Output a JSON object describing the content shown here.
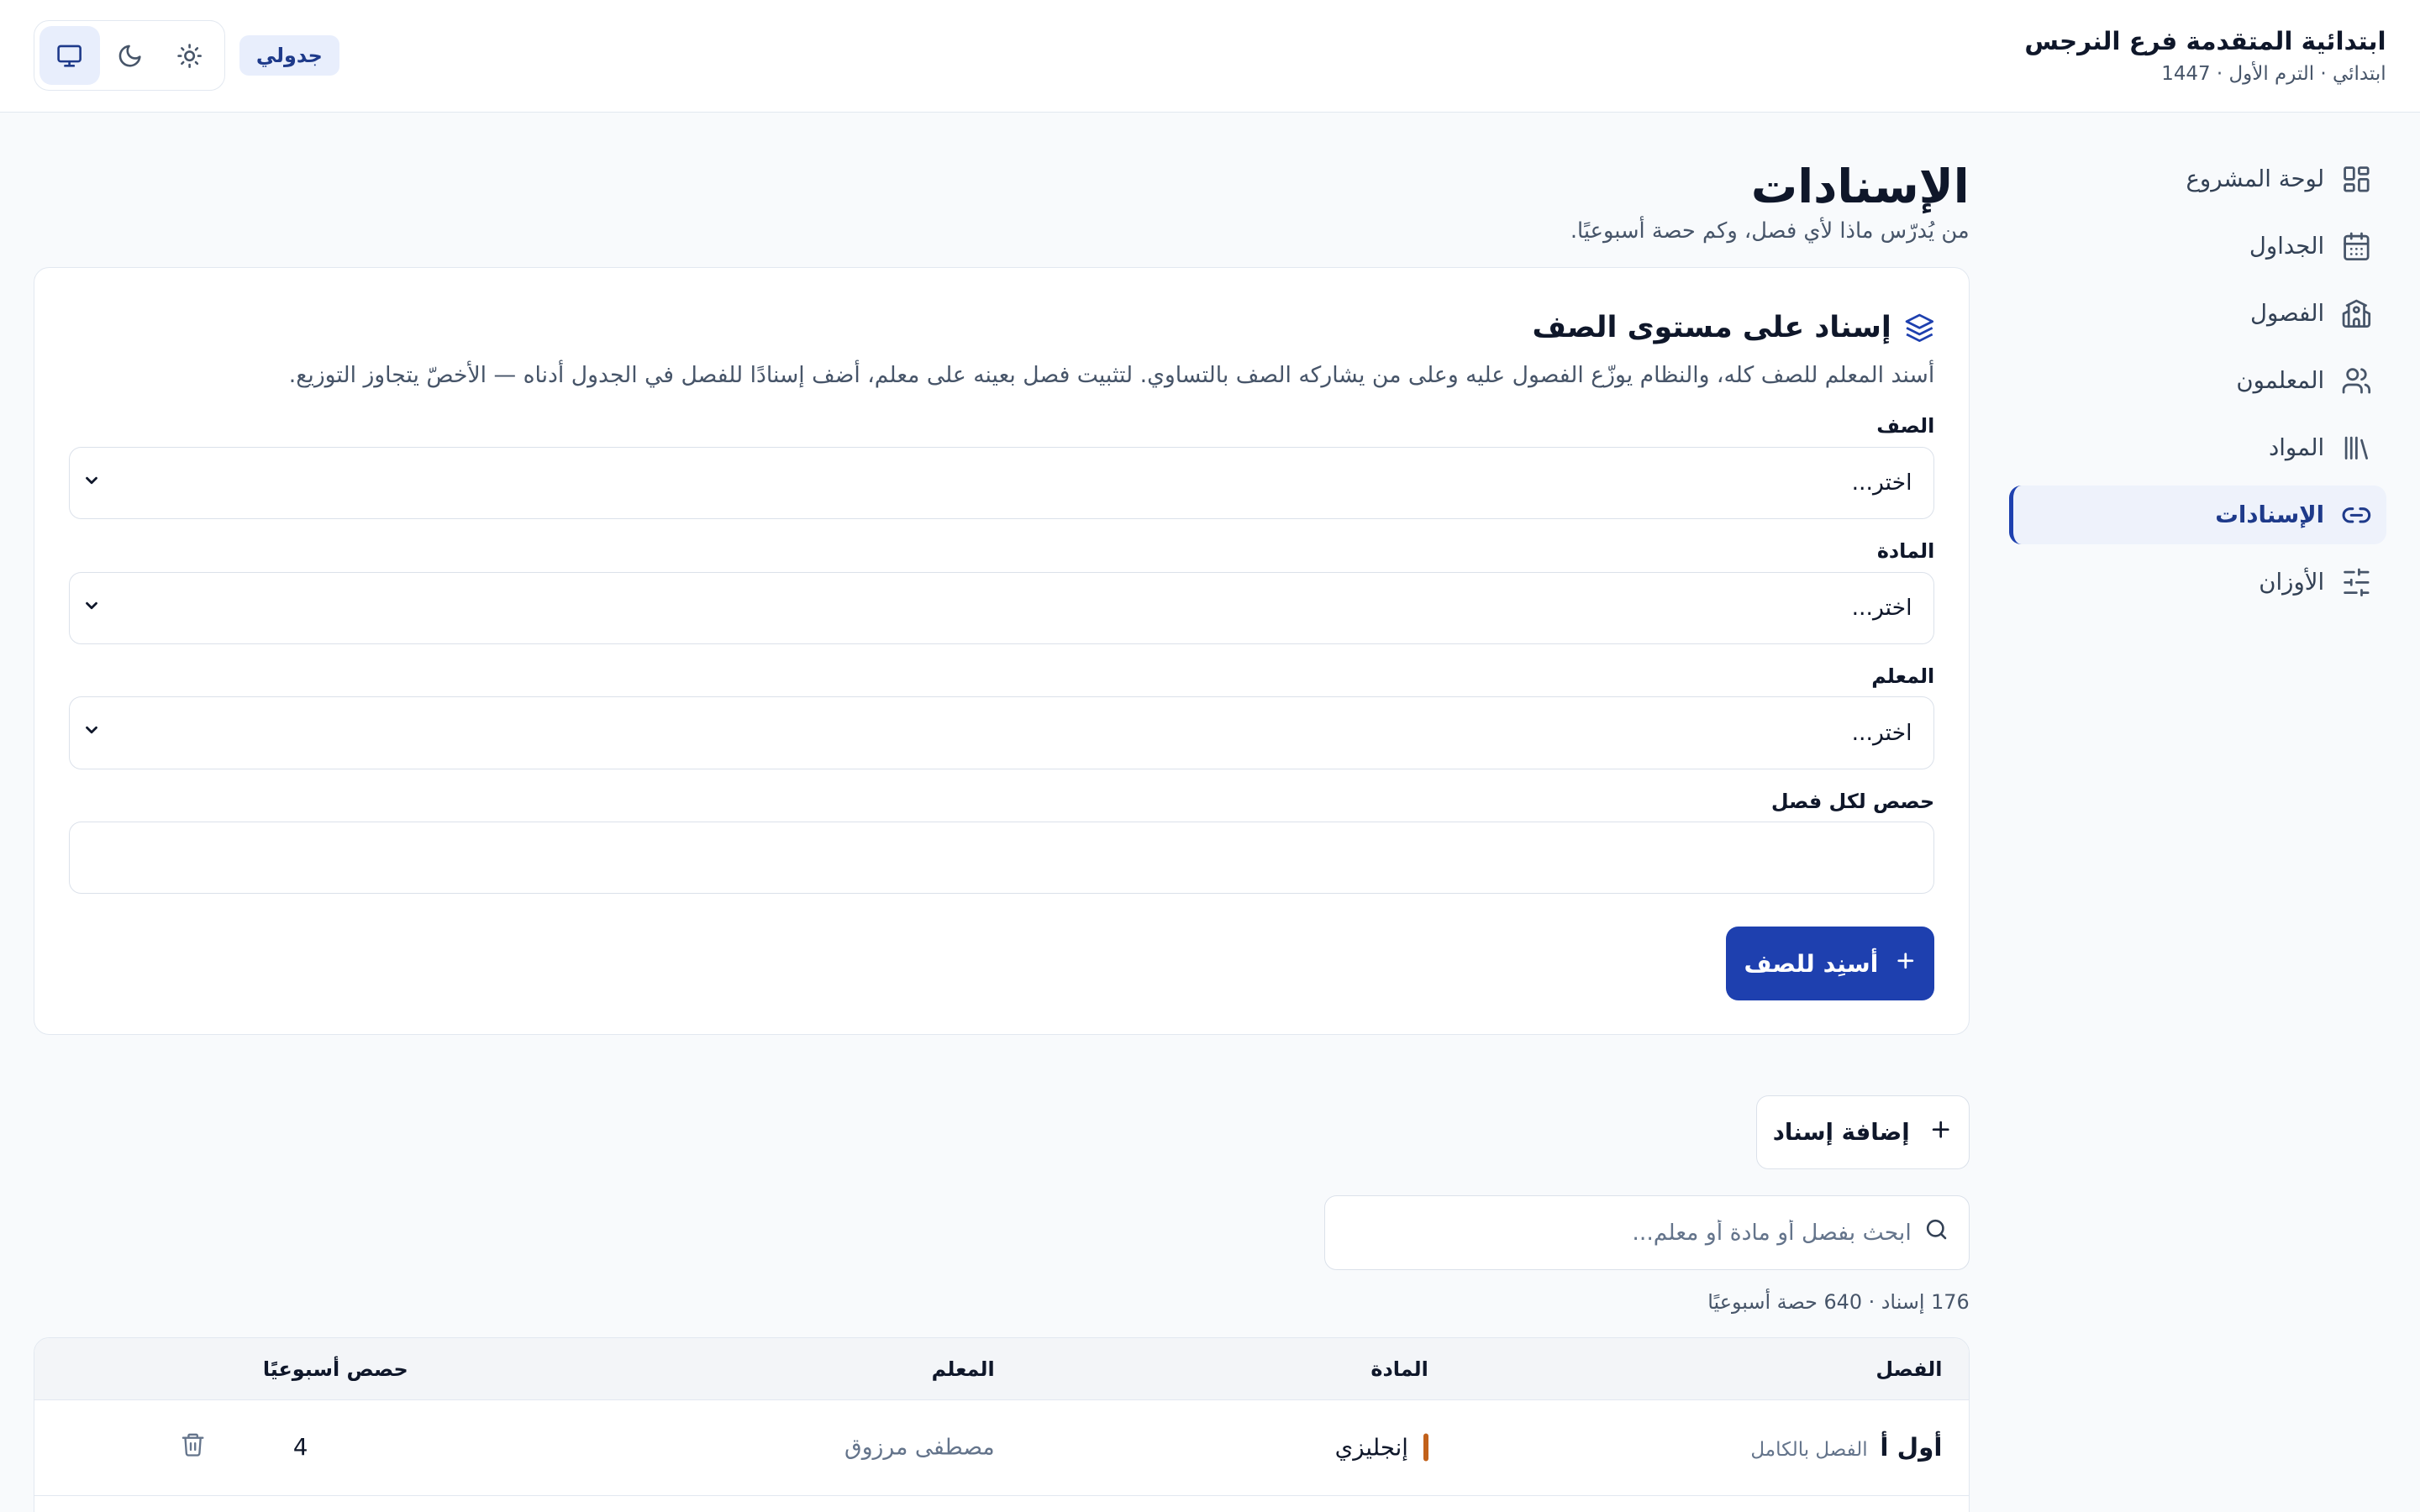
{
  "header": {
    "school_name": "ابتدائية المتقدمة فرع النرجس",
    "school_meta": "ابتدائي · الترم الأول · 1447",
    "app_badge": "جدولي"
  },
  "sidebar": {
    "items": [
      {
        "label": "لوحة المشروع",
        "icon": "grid-icon"
      },
      {
        "label": "الجداول",
        "icon": "calendar-icon"
      },
      {
        "label": "الفصول",
        "icon": "school-icon"
      },
      {
        "label": "المعلمون",
        "icon": "users-icon"
      },
      {
        "label": "المواد",
        "icon": "library-icon"
      },
      {
        "label": "الإسنادات",
        "icon": "link-icon",
        "active": true
      },
      {
        "label": "الأوزان",
        "icon": "sliders-icon"
      }
    ]
  },
  "page": {
    "title": "الإسنادات",
    "subtitle": "من يُدرّس ماذا لأي فصل، وكم حصة أسبوعيًا."
  },
  "grade_card": {
    "title": "إسناد على مستوى الصف",
    "description": "أسند المعلم للصف كله، والنظام يوزّع الفصول عليه وعلى من يشاركه الصف بالتساوي. لتثبيت فصل بعينه على معلم، أضف إسنادًا للفصل في الجدول أدناه — الأخصّ يتجاوز التوزيع.",
    "grade_label": "الصف",
    "grade_value": "اختر...",
    "subject_label": "المادة",
    "subject_value": "اختر...",
    "teacher_label": "المعلم",
    "teacher_value": "اختر...",
    "periods_label": "حصص لكل فصل",
    "periods_value": "",
    "submit_label": "أسنِد للصف"
  },
  "actions": {
    "add_label": "إضافة إسناد",
    "search_placeholder": "ابحث بفصل أو مادة أو معلم...",
    "summary": "176 إسناد · 640 حصة أسبوعيًا"
  },
  "table": {
    "columns": {
      "class": "الفصل",
      "subject": "المادة",
      "teacher": "المعلم",
      "periods": "حصص أسبوعيًا"
    },
    "rows": [
      {
        "class": "أول أ",
        "scope": "الفصل بالكامل",
        "subject": "إنجليزي",
        "subject_color": "#c2611a",
        "teacher": "مصطفى مرزوق",
        "periods": "4"
      }
    ]
  },
  "colors": {
    "accent": "#1e40af",
    "accent_soft": "#e8eefc",
    "subject_english": "#c2611a"
  }
}
